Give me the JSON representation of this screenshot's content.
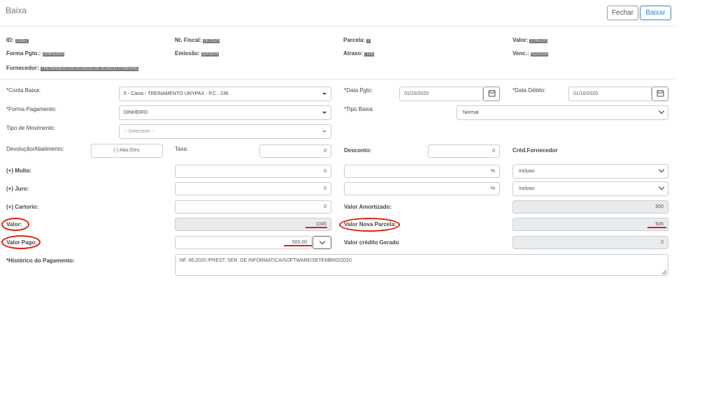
{
  "header": {
    "title": "Baixa",
    "fechar": "Fechar",
    "baixar": "Baixar"
  },
  "info": {
    "id_label": "ID:",
    "id_value": "21657",
    "nf_label": "Nt. Fiscal:",
    "nf_value": "06.2020",
    "parcela_label": "Parcela:",
    "parcela_value": "1",
    "valor_label": "Valor:",
    "valor_value": "1.045,00",
    "forma_label": "Forma Pgto.:",
    "forma_value": "DINHEIRO",
    "emissao_label": "Emissão:",
    "emissao_value": "18/08/20",
    "atraso_label": "Atraso:",
    "atraso_value": "-105",
    "venc_label": "Venc.:",
    "venc_value": "01/10/20",
    "fornecedor_label": "Fornecedor:",
    "fornecedor_value": "TREINAMENTOS PLANOS DE AUXILIO FUNERAL"
  },
  "form": {
    "conta_baixa_label": "*Conta Baixa:",
    "conta_baixa_value": "5 - Caixa - TREINAMENTO UNYPAX - P.C.: 236",
    "data_pgto_label": "*Data Pgto:",
    "data_pgto_value": "01/10/2020",
    "data_debito_label": "*Data Débito:",
    "data_debito_value": "01/10/2020",
    "forma_pagamento_label": "*Forma Pagamento:",
    "forma_pagamento_value": "DINHEIRO",
    "tipo_baixa_label": "*Tipo Baixa:",
    "tipo_baixa_value": "Normal",
    "tipo_movimento_label": "Tipo de Movimento:",
    "tipo_movimento_placeholder": "-- Selecione --",
    "devolucao_label": "Devolução/Abatimento:",
    "devolucao_placeholder": "(-) Aba./Dev.",
    "taxa_label": "Taxa:",
    "taxa_value": "0",
    "desconto_label": "Desconto:",
    "desconto_value": "0",
    "cred_fornecedor_label": "Créd.Fornecedor",
    "multa_label": "(+) Multa:",
    "multa_value": "0",
    "multa_pct": "%",
    "multa_option": "Incluso",
    "juro_label": "(+) Juro:",
    "juro_value": "0",
    "juro_pct": "%",
    "juro_option": "Incluso",
    "cartorio_label": "(+) Cartorio:",
    "cartorio_value": "0",
    "valor_amortizado_label": "Valor Amortizado:",
    "valor_amortizado_value": "500",
    "valor_label": "Valor:",
    "valor_value": "1045",
    "valor_nova_parcela_label": "Valor Nova Parcela:",
    "valor_nova_parcela_value": "545",
    "valor_pago_label": "Valor Pago:",
    "valor_pago_value": "500,00",
    "valor_credito_label": "Valor crédito Gerado",
    "valor_credito_value": "0",
    "historico_label": "*Histórico do Pagamento:",
    "historico_value": "NF. 06.2020 /PREST. SER. DE INFORMATICA/SOFTWARE/SETEMBRO/2020"
  },
  "colors": {
    "annotation": "#d21111",
    "primary": "#3a7fd5",
    "readonly_bg": "#e9ecef"
  }
}
